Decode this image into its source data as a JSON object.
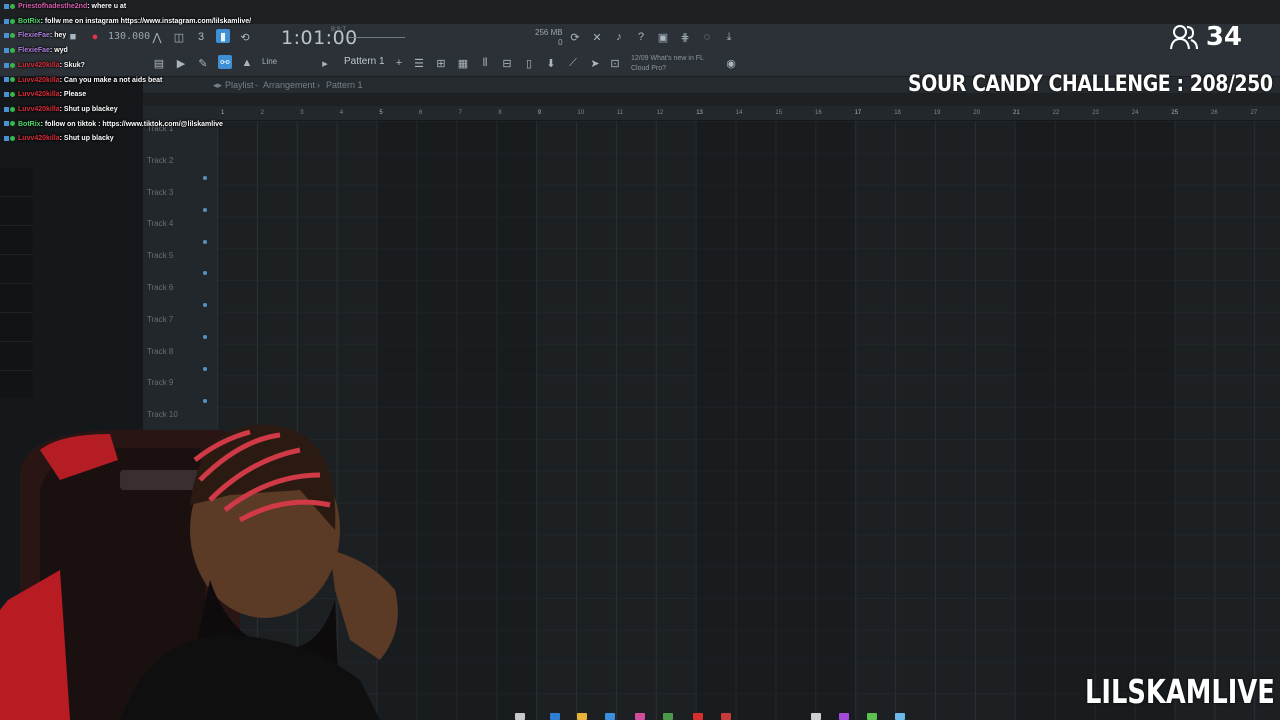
{
  "daw": {
    "tempo": "130.000",
    "time": "1:01:00",
    "time_sup": "B:S:T",
    "memory_line1": "256 MB",
    "memory_line2": "0",
    "pattern": "Pattern 1",
    "line_mode": "Line",
    "whats_new_date": "12/09",
    "whats_new_title": "What's new in FL",
    "whats_new_sub": "Cloud Pro?",
    "breadcrumb": [
      "Playlist",
      "Arrangement",
      "Pattern 1"
    ],
    "ruler": [
      "1",
      "2",
      "3",
      "4",
      "5",
      "6",
      "7",
      "8",
      "9",
      "10",
      "11",
      "12",
      "13",
      "14",
      "15",
      "16",
      "17",
      "18",
      "19",
      "20",
      "21",
      "22",
      "23",
      "24",
      "25",
      "26",
      "27"
    ],
    "tracks": [
      "Track 1",
      "Track 2",
      "Track 3",
      "Track 4",
      "Track 5",
      "Track 6",
      "Track 7",
      "Track 8",
      "Track 9",
      "Track 10"
    ]
  },
  "chat": [
    {
      "user": "Priestofhadesthe2nd",
      "msg": ": where u at",
      "color": "#d65db1"
    },
    {
      "user": "BotRix",
      "msg": ": follw me on instagram https://www.instagram.com/lilskamlive/",
      "color": "#51d86b"
    },
    {
      "user": "FlexieFae",
      "msg": ": hey",
      "color": "#b07fdf"
    },
    {
      "user": "FlexieFae",
      "msg": ": wyd",
      "color": "#b07fdf"
    },
    {
      "user": "Luvv420killa",
      "msg": ": Skuk?",
      "color": "#d92d3a"
    },
    {
      "user": "Luvv420killa",
      "msg": ": Can you make a not aids beat",
      "color": "#d92d3a"
    },
    {
      "user": "Luvv420killa",
      "msg": ": Please",
      "color": "#d92d3a"
    },
    {
      "user": "Luvv420killa",
      "msg": ": Shut up blackey",
      "color": "#d92d3a"
    },
    {
      "user": "BotRix",
      "msg": ": follow on tiktok : https://www.tiktok.com/@lilskamlive",
      "color": "#51d86b"
    },
    {
      "user": "Luvv420killa",
      "msg": ": Shut up blacky",
      "color": "#d92d3a"
    }
  ],
  "overlay": {
    "viewers": "34",
    "challenge": "SOUR CANDY CHALLENGE : 208/250",
    "channel": "LILSKAMLIVE"
  }
}
